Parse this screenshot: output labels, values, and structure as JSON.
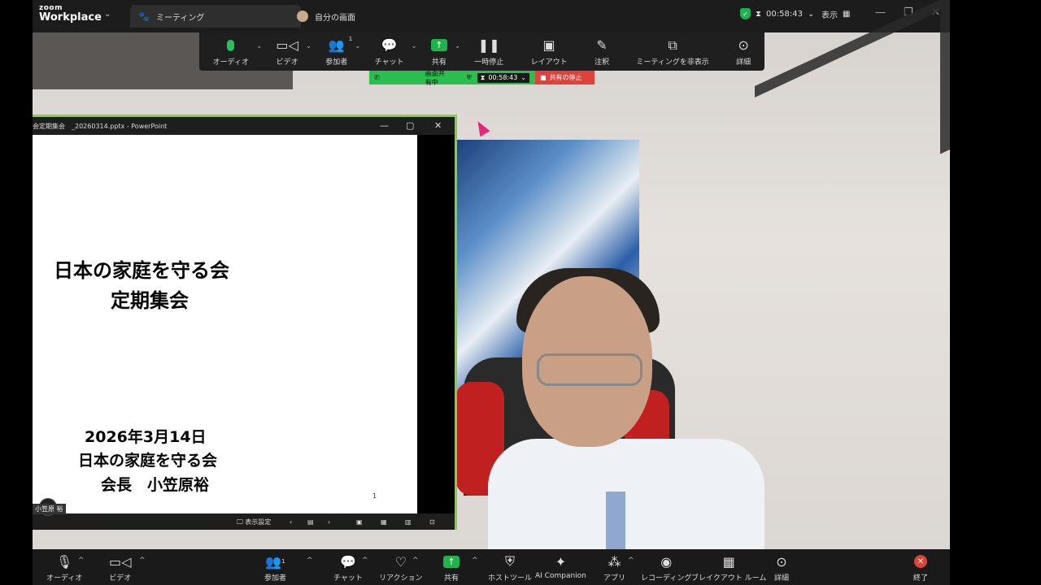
{
  "app": {
    "brand_small": "zoom",
    "brand_name": "Workplace"
  },
  "tabs": [
    {
      "label": "ミーティング",
      "icon": "paw-icon"
    },
    {
      "label": "自分の画面",
      "icon": "avatar-icon"
    }
  ],
  "top_right": {
    "timer": "00:58:43",
    "view_label": "表示"
  },
  "floating_toolbar": [
    {
      "label": "オーディオ",
      "icon": "mic-icon"
    },
    {
      "label": "ビデオ",
      "icon": "video-icon"
    },
    {
      "label": "参加者",
      "icon": "participants-icon",
      "count": "1"
    },
    {
      "label": "チャット",
      "icon": "chat-icon"
    },
    {
      "label": "共有",
      "icon": "share-icon"
    },
    {
      "label": "一時停止",
      "icon": "pause-icon"
    },
    {
      "label": "レイアウト",
      "icon": "layout-icon"
    },
    {
      "label": "注釈",
      "icon": "pen-icon"
    },
    {
      "label": "ミーティングを非表示",
      "icon": "hide-icon"
    },
    {
      "label": "詳細",
      "icon": "more-icon"
    }
  ],
  "share_strip": {
    "status": "画面共有中",
    "timer": "00:58:43",
    "stop_label": "共有の停止"
  },
  "ppt": {
    "window_title": "会定期集会　_20260314.pptx  -  PowerPoint",
    "slide_title_1": "日本の家庭を守る会",
    "slide_title_2": "定期集会",
    "slide_date": "2026年3月14日",
    "slide_org": "日本の家庭を守る会",
    "slide_person": "会長　小笠原裕",
    "page_number": "1",
    "status_display": "表示設定"
  },
  "participant_name": "小笠原 裕",
  "bottom_toolbar": [
    {
      "label": "オーディオ",
      "icon": "mic-icon"
    },
    {
      "label": "ビデオ",
      "icon": "video-icon"
    },
    {
      "label": "参加者",
      "icon": "participants-icon",
      "count": "1"
    },
    {
      "label": "チャット",
      "icon": "chat-icon"
    },
    {
      "label": "リアクション",
      "icon": "heart-icon"
    },
    {
      "label": "共有",
      "icon": "share-icon"
    },
    {
      "label": "ホストツール",
      "icon": "shield-icon"
    },
    {
      "label": "AI Companion",
      "icon": "sparkle-icon"
    },
    {
      "label": "アプリ",
      "icon": "apps-icon"
    },
    {
      "label": "レコーディング",
      "icon": "record-icon"
    },
    {
      "label": "ブレイクアウト ルーム",
      "icon": "breakout-icon"
    },
    {
      "label": "詳細",
      "icon": "more-icon"
    },
    {
      "label": "終了",
      "icon": "end-icon"
    }
  ],
  "colors": {
    "share_green": "#2bbd4f",
    "stop_red": "#e0413a",
    "ppt_border": "#7ed13f"
  }
}
